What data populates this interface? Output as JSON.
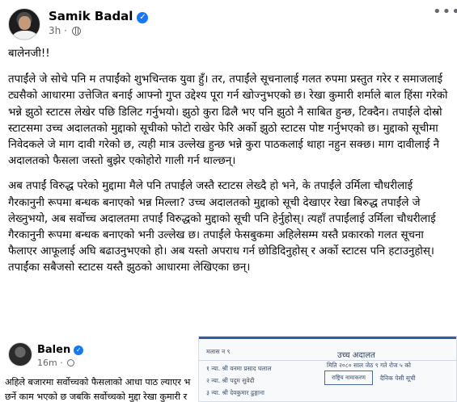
{
  "post": {
    "author": "Samik Badal",
    "time": "3h",
    "greeting": "बालेनजी!!",
    "paragraph1": "तपाईंले जे सोचे पनि म तपाईंको शुभचिन्तक युवा हुँ। तर, तपाईंले सूचनालाई गलत रुपमा प्रस्तुत गरेर र समाजलाई ट्यसैको आधारमा उत्तेजित बनाई आफ्नो गुप्त उद्देश्य पूरा गर्न खोज्नुभएको छ। रेखा कुमारी शर्माले बाल हिंसा गरेको भन्ने झुठो स्टाटस लेखेर पछि डिलिट गर्नुभयो। झुठो कुरा ढिलै भए पनि झुठो नै साबित हुन्छ, टिक्दैन। तपाईंले दोस्रो स्टाटसमा उच्च अदालतको मुद्दाको सूचीको फोटो राखेर फेरि अर्को झुठो स्टाटस पोष्ट गर्नुभएको छ। मुद्दाको सूचीमा निवेदकले जे माग दावी गरेको छ, त्यही मात्र उल्लेख हुन्छ भन्ने कुरा पाठकलाई थाहा नहुन सक्छ। माग दावीलाई नै अदालतको फैसला जस्तो बुझेर एकोहोरो गाली गर्न थाल्छन्।",
    "paragraph2": "अब तपाईं विरुद्ध परेको मुद्दामा मैले पनि तपाईंले जस्तै स्टाटस लेख्दै हो भने, के तपाईंले उर्मिला चौधरीलाई गैरकानुनी रूपमा बन्धक बनाएको भन्न मिल्ला? उच्च अदालतको मुद्दाको सूची देखाएर रेखा बिरुद्ध तपाईंले जे लेख्नुभयो, अब सर्वोच्च अदालतमा तपाईं विरुद्धको मुद्दाको सूची पनि हेर्नुहोस्। त्यहाँ तपाईंलाई उर्मिला चौधरीलाई गैरकानुनी रूपमा बन्धक बनाएको भनी उल्लेख छ। तपाईंले फेसबुकमा अहिलेसम्म यस्तै प्रकारको गलत सूचना फैलाएर आफूलाई अघि बढाउनुभएको हो। अब यस्तो अपराध गर्न छोडिदिनुहोस् र अर्को स्टाटस पनि हटाउनुहोस्। तपाईंका सबैजसो स्टाटस यस्तै झुठको आधारमा लेखिएका छन्।"
  },
  "embedded_post": {
    "author": "Balen",
    "time": "16m",
    "line1": "अहिले बजारमा सर्वोच्चको फैसलाको आधा पाठ ल्याएर भ",
    "line2": "छर्ने काम भएको छ जबकि सर्वोच्चको मुद्दा रेखा कुमारी र"
  },
  "embedded_document": {
    "court": "उच्च अदालत",
    "header_left": "मलास न ९",
    "rows": [
      "१  न्या. श्री वनमा प्रसाद घलाल",
      "२  न्या. श्री पदुम सुवेदी",
      "३  न्या. श्री देवकुमार ढुङ्गाना"
    ],
    "box_text": "राष्ट्रिय नामाकरण",
    "right_text": "मिति २०८० साल जेठ ९ गते रोज ५ को",
    "right_text2": "दैनिक पेसी सूची"
  },
  "colors": {
    "text": "#050505",
    "meta": "#65676b",
    "verified": "#1877f2"
  },
  "icons": {
    "verified": "verified-badge-icon",
    "audience": "globe-icon",
    "more": "more-options-icon"
  }
}
